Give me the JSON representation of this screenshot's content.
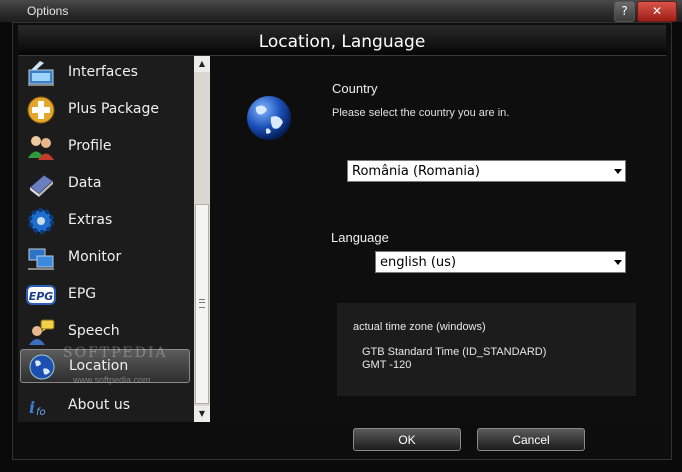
{
  "window": {
    "title": "Options",
    "help_label": "?",
    "close_label": "✕"
  },
  "header": {
    "title": "Location, Language"
  },
  "sidebar": {
    "items": [
      {
        "label": "Interfaces",
        "icon": "interfaces-icon"
      },
      {
        "label": "Plus Package",
        "icon": "plus-package-icon"
      },
      {
        "label": "Profile",
        "icon": "profile-icon"
      },
      {
        "label": "Data",
        "icon": "data-icon"
      },
      {
        "label": "Extras",
        "icon": "extras-icon"
      },
      {
        "label": "Monitor",
        "icon": "monitor-icon"
      },
      {
        "label": "EPG",
        "icon": "epg-icon"
      },
      {
        "label": "Speech",
        "icon": "speech-icon"
      },
      {
        "label": "Location",
        "icon": "location-globe-icon",
        "selected": true
      },
      {
        "label": "About us",
        "icon": "info-icon"
      }
    ],
    "epg_badge": "EPG",
    "watermark": "SOFTPEDIA",
    "watermark_url": "www.softpedia.com"
  },
  "scrollbar": {
    "up_arrow": "▲",
    "down_arrow": "▼"
  },
  "country": {
    "label": "Country",
    "hint": "Please select the country you are in.",
    "selected": "România  (Romania)"
  },
  "language": {
    "label": "Language",
    "selected": "english (us)"
  },
  "timezone": {
    "heading": "actual time zone (windows)",
    "name": "GTB Standard Time (ID_STANDARD)",
    "offset": "GMT -120"
  },
  "buttons": {
    "ok": "OK",
    "cancel": "Cancel"
  },
  "colors": {
    "background": "#0a0a0a",
    "selected_item": "#4a4a4a",
    "text": "#f0f0f0"
  }
}
